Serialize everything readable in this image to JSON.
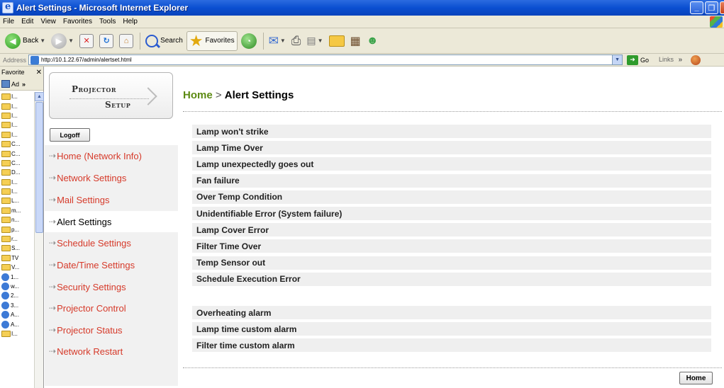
{
  "window": {
    "title": "Alert Settings - Microsoft Internet Explorer"
  },
  "menu": [
    "File",
    "Edit",
    "View",
    "Favorites",
    "Tools",
    "Help"
  ],
  "toolbar": {
    "back_label": "Back",
    "search_label": "Search",
    "favorites_label": "Favorites"
  },
  "address": {
    "label": "Address",
    "url": "http://10.1.22.67/admin/alertset.html",
    "go_label": "Go",
    "links_label": "Links"
  },
  "favorites_pane": {
    "title": "Favorite",
    "add_label": "Ad",
    "items": [
      {
        "label": "I...",
        "icon": "folder"
      },
      {
        "label": "I...",
        "icon": "folder"
      },
      {
        "label": "I...",
        "icon": "folder"
      },
      {
        "label": "I...",
        "icon": "folder"
      },
      {
        "label": "I...",
        "icon": "folder"
      },
      {
        "label": "C...",
        "icon": "folder"
      },
      {
        "label": "C...",
        "icon": "folder"
      },
      {
        "label": "C...",
        "icon": "folder"
      },
      {
        "label": "D...",
        "icon": "folder"
      },
      {
        "label": "I...",
        "icon": "folder"
      },
      {
        "label": "I...",
        "icon": "folder"
      },
      {
        "label": "L...",
        "icon": "folder"
      },
      {
        "label": "m...",
        "icon": "folder"
      },
      {
        "label": "n...",
        "icon": "folder"
      },
      {
        "label": "p...",
        "icon": "folder"
      },
      {
        "label": "r...",
        "icon": "folder"
      },
      {
        "label": "S...",
        "icon": "folder"
      },
      {
        "label": "TV",
        "icon": "folder"
      },
      {
        "label": "V...",
        "icon": "folder"
      },
      {
        "label": "1...",
        "icon": "page"
      },
      {
        "label": "w...",
        "icon": "page"
      },
      {
        "label": "2...",
        "icon": "page"
      },
      {
        "label": "3...",
        "icon": "page"
      },
      {
        "label": "A...",
        "icon": "page"
      },
      {
        "label": "A...",
        "icon": "page"
      },
      {
        "label": "I...",
        "icon": "folder"
      }
    ]
  },
  "logo": {
    "line1": "Projector",
    "line2": "Setup"
  },
  "logoff_label": "Logoff",
  "nav": [
    {
      "label": "Home (Network Info)",
      "current": false
    },
    {
      "label": "Network Settings",
      "current": false
    },
    {
      "label": "Mail Settings",
      "current": false
    },
    {
      "label": "Alert Settings",
      "current": true
    },
    {
      "label": "Schedule Settings",
      "current": false
    },
    {
      "label": "Date/Time Settings",
      "current": false
    },
    {
      "label": "Security Settings",
      "current": false
    },
    {
      "label": "Projector Control",
      "current": false
    },
    {
      "label": "Projector Status",
      "current": false
    },
    {
      "label": "Network Restart",
      "current": false
    }
  ],
  "breadcrumb": {
    "home": "Home",
    "separator": " > ",
    "current": "Alert Settings"
  },
  "alerts_group1": [
    "Lamp won't strike",
    "Lamp Time Over",
    "Lamp unexpectedly goes out",
    "Fan failure",
    "Over Temp Condition",
    "Unidentifiable Error (System failure)",
    "Lamp Cover Error",
    "Filter Time Over",
    "Temp Sensor out",
    "Schedule Execution Error"
  ],
  "alerts_group2": [
    "Overheating alarm",
    "Lamp time custom alarm",
    "Filter time custom alarm"
  ],
  "home_button_label": "Home",
  "colors": {
    "nav_link": "#d63a2a",
    "breadcrumb_home": "#5c8a12",
    "titlebar": "#0a4fd1"
  }
}
